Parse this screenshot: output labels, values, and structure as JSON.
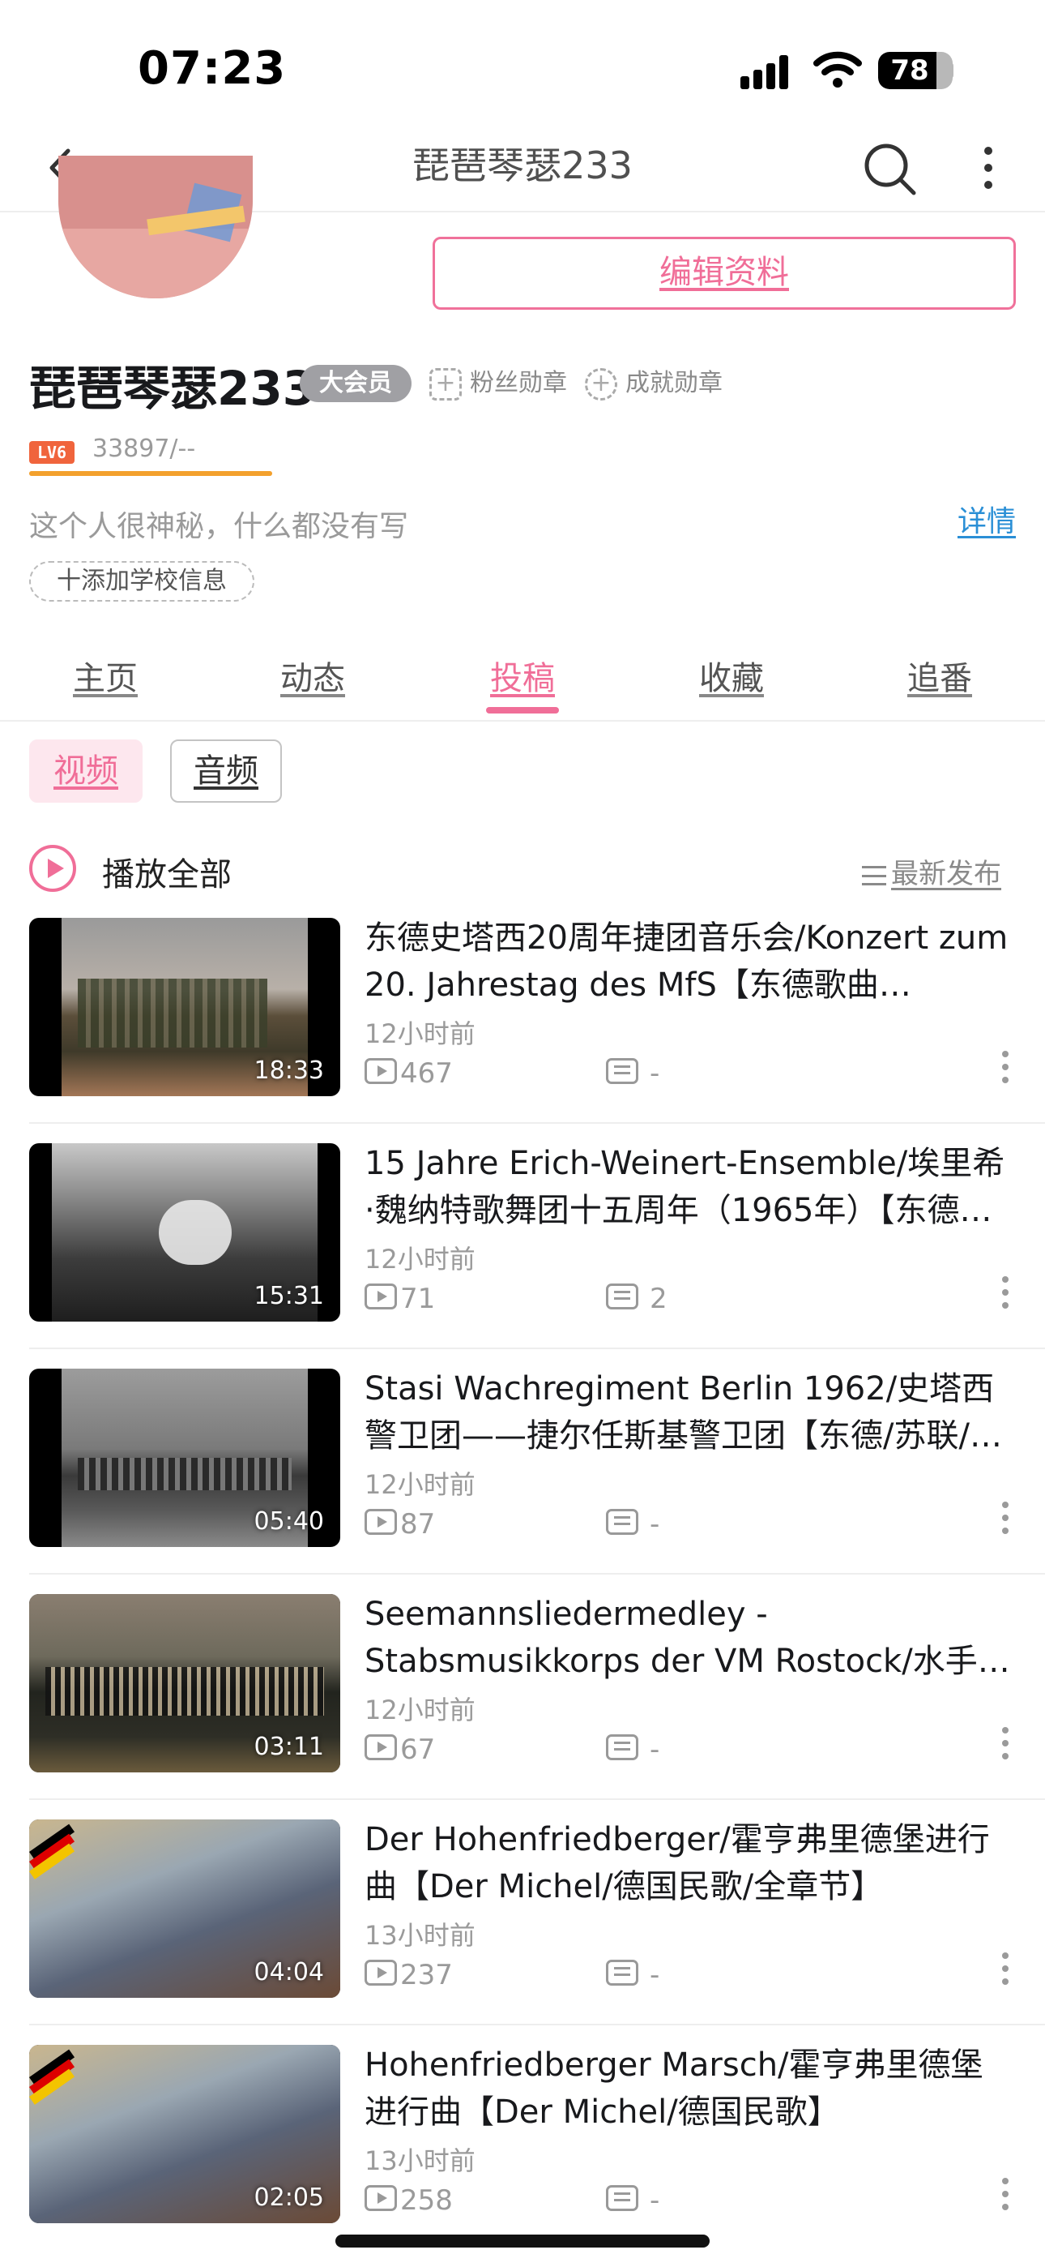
{
  "status_bar": {
    "time": "07:23",
    "battery": "78"
  },
  "nav": {
    "title": "琵琶琴瑟233"
  },
  "profile": {
    "edit_label": "编辑资料",
    "username": "琵琶琴瑟233",
    "vip_label": "大会员",
    "fan_medal_label": "粉丝勋章",
    "achievement_medal_label": "成就勋章",
    "level_label": "LV6",
    "exp_text": "33897/--",
    "exp_progress_percent": 100,
    "bio": "这个人很神秘，什么都没有写",
    "detail_link": "详情",
    "add_school_label": "十添加学校信息"
  },
  "tabs": [
    {
      "label": "主页",
      "active": false
    },
    {
      "label": "动态",
      "active": false
    },
    {
      "label": "投稿",
      "active": true
    },
    {
      "label": "收藏",
      "active": false
    },
    {
      "label": "追番",
      "active": false
    }
  ],
  "filters": {
    "video": "视频",
    "audio": "音频"
  },
  "list_header": {
    "play_all": "播放全部",
    "sort": "最新发布"
  },
  "colors": {
    "accent": "#f06e98",
    "link": "#2a8fd6",
    "level": "#f0643c"
  },
  "videos": [
    {
      "title": "东德史塔西20周年捷团音乐会/Konzert zum 20. Jahrestag des MfS【东德歌曲…",
      "duration": "18:33",
      "time": "12小时前",
      "plays": "467",
      "danmaku": "-"
    },
    {
      "title": "15 Jahre Erich-Weinert-Ensemble/埃里希·魏纳特歌舞团十五周年（1965年）【东德…",
      "duration": "15:31",
      "time": "12小时前",
      "plays": "71",
      "danmaku": "2"
    },
    {
      "title": "Stasi Wachregiment Berlin 1962/史塔西警卫团——捷尔任斯基警卫团【东德/苏联/…",
      "duration": "05:40",
      "time": "12小时前",
      "plays": "87",
      "danmaku": "-"
    },
    {
      "title": "Seemannsliedermedley - Stabsmusikkorps der VM Rostock/水手…",
      "duration": "03:11",
      "time": "12小时前",
      "plays": "67",
      "danmaku": "-"
    },
    {
      "title": "Der Hohenfriedberger/霍亨弗里德堡进行曲【Der Michel/德国民歌/全章节】",
      "duration": "04:04",
      "time": "13小时前",
      "plays": "237",
      "danmaku": "-"
    },
    {
      "title": "Hohenfriedberger Marsch/霍亨弗里德堡进行曲【Der Michel/德国民歌】",
      "duration": "02:05",
      "time": "13小时前",
      "plays": "258",
      "danmaku": "-"
    }
  ]
}
